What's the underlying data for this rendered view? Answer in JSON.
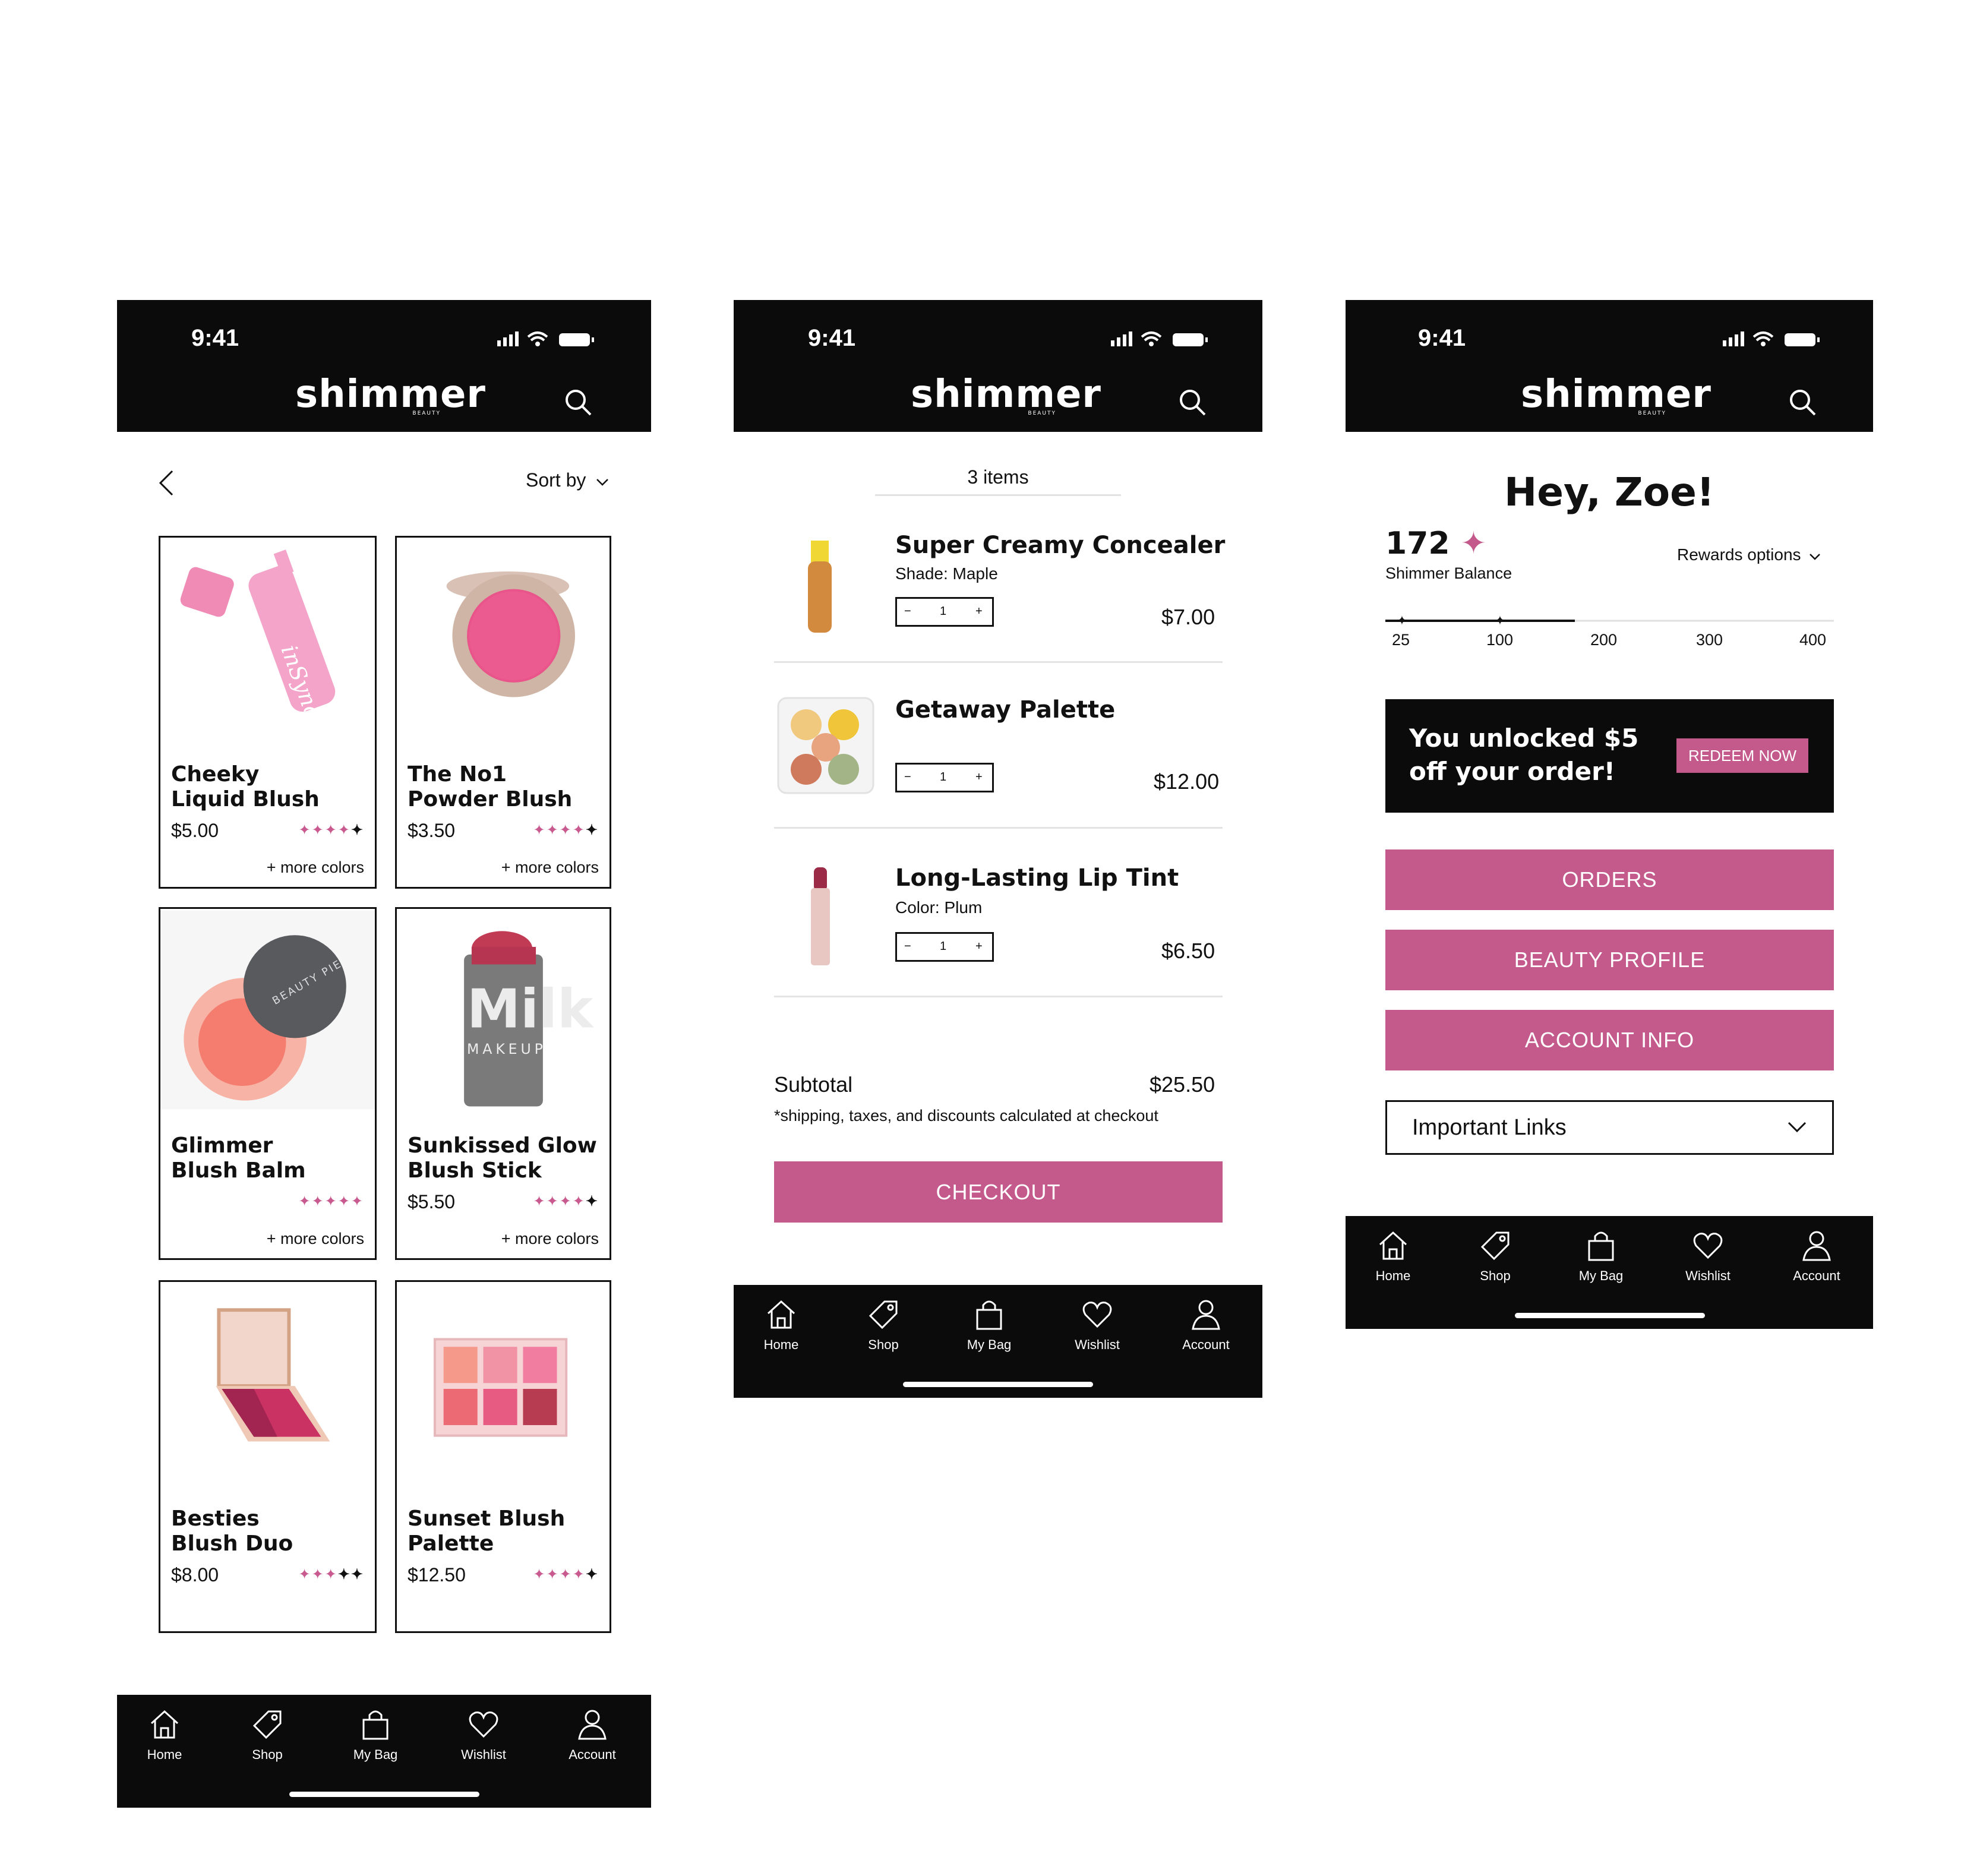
{
  "status_time": "9:41",
  "brand": {
    "logo": "shimmer",
    "sub": "BEAUTY"
  },
  "colors": {
    "accent": "#c45a8c",
    "dark": "#0b0b0b"
  },
  "nav": [
    "Home",
    "Shop",
    "My Bag",
    "Wishlist",
    "Account"
  ],
  "shop": {
    "sort_label": "Sort by",
    "products": [
      {
        "name1": "Cheeky",
        "name2": "Liquid Blush",
        "price": "$5.00",
        "more": "+ more colors",
        "stars": "4 of 5"
      },
      {
        "name1": "The No1",
        "name2": "Powder Blush",
        "price": "$3.50",
        "more": "+ more colors",
        "stars": "4 of 5"
      },
      {
        "name1": "Glimmer",
        "name2": "Blush Balm",
        "price": "",
        "more": "+ more colors",
        "stars": "5 of 5"
      },
      {
        "name1": "Sunkissed Glow",
        "name2": "Blush Stick",
        "price": "$5.50",
        "more": "+ more colors",
        "stars": "4 of 5"
      },
      {
        "name1": "Besties",
        "name2": "Blush Duo",
        "price": "$8.00",
        "more": "",
        "stars": "3 of 5"
      },
      {
        "name1": "Sunset Blush",
        "name2": "Palette",
        "price": "$12.50",
        "more": "",
        "stars": "4 of 5"
      }
    ]
  },
  "bag": {
    "count_label": "3 items",
    "items": [
      {
        "name": "Super Creamy Concealer",
        "detail": "Shade: Maple",
        "qty": "1",
        "price": "$7.00"
      },
      {
        "name": "Getaway Palette",
        "detail": "",
        "qty": "1",
        "price": "$12.00"
      },
      {
        "name": "Long-Lasting Lip Tint",
        "detail": "Color: Plum",
        "qty": "1",
        "price": "$6.50"
      }
    ],
    "subtotal_label": "Subtotal",
    "subtotal_value": "$25.50",
    "note": "*shipping, taxes, and discounts calculated at checkout",
    "checkout": "CHECKOUT"
  },
  "account": {
    "greeting": "Hey, Zoe!",
    "points": "172",
    "balance_label": "Shimmer Balance",
    "rewards_label": "Rewards options",
    "ticks": [
      "25",
      "100",
      "200",
      "300",
      "400"
    ],
    "progress_value": 172,
    "promo_line1": "You unlocked $5",
    "promo_line2": "off your order!",
    "redeem": "REDEEM NOW",
    "buttons": [
      "ORDERS",
      "BEAUTY PROFILE",
      "ACCOUNT INFO"
    ],
    "links_label": "Important Links"
  },
  "product_images": {
    "p1": "Pink liquid blush tube marked inSync",
    "p4": "Milk Makeup blush stick"
  },
  "image_text": {
    "milk": "Milk",
    "makeup": "MAKEUP",
    "insync": "inSync",
    "beautypie": "BEAUTY PIE"
  }
}
